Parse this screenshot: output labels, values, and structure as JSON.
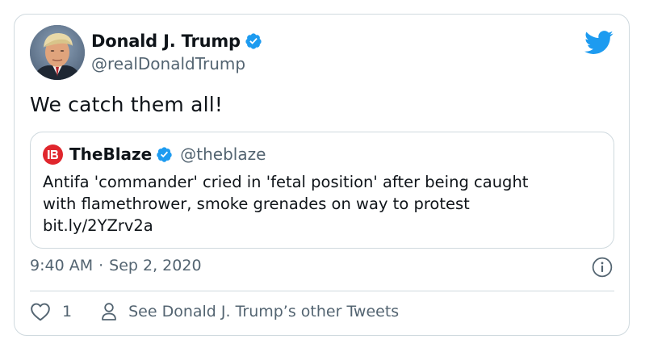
{
  "author": {
    "name": "Donald J. Trump",
    "handle": "@realDonaldTrump"
  },
  "tweet": {
    "text": "We catch them all!"
  },
  "quoted": {
    "name": "TheBlaze",
    "handle": "@theblaze",
    "lines": [
      "Antifa 'commander' cried in 'fetal position' after being caught",
      "with flamethrower, smoke grenades on way to protest",
      "bit.ly/2YZrv2a"
    ]
  },
  "meta": {
    "time": "9:40 AM",
    "separator": "·",
    "date": "Sep 2, 2020"
  },
  "actions": {
    "like_count": "1",
    "other_tweets_label": "See Donald J. Trump’s other Tweets"
  },
  "colors": {
    "twitter_blue": "#1d9bf0",
    "blaze_red": "#e0262d",
    "secondary_text": "#536471",
    "border": "#cfd9de"
  },
  "icons": {
    "brand": "twitter-bird-icon",
    "verified": "verified-badge-icon",
    "info": "info-icon",
    "like": "heart-icon",
    "profile": "person-icon"
  }
}
